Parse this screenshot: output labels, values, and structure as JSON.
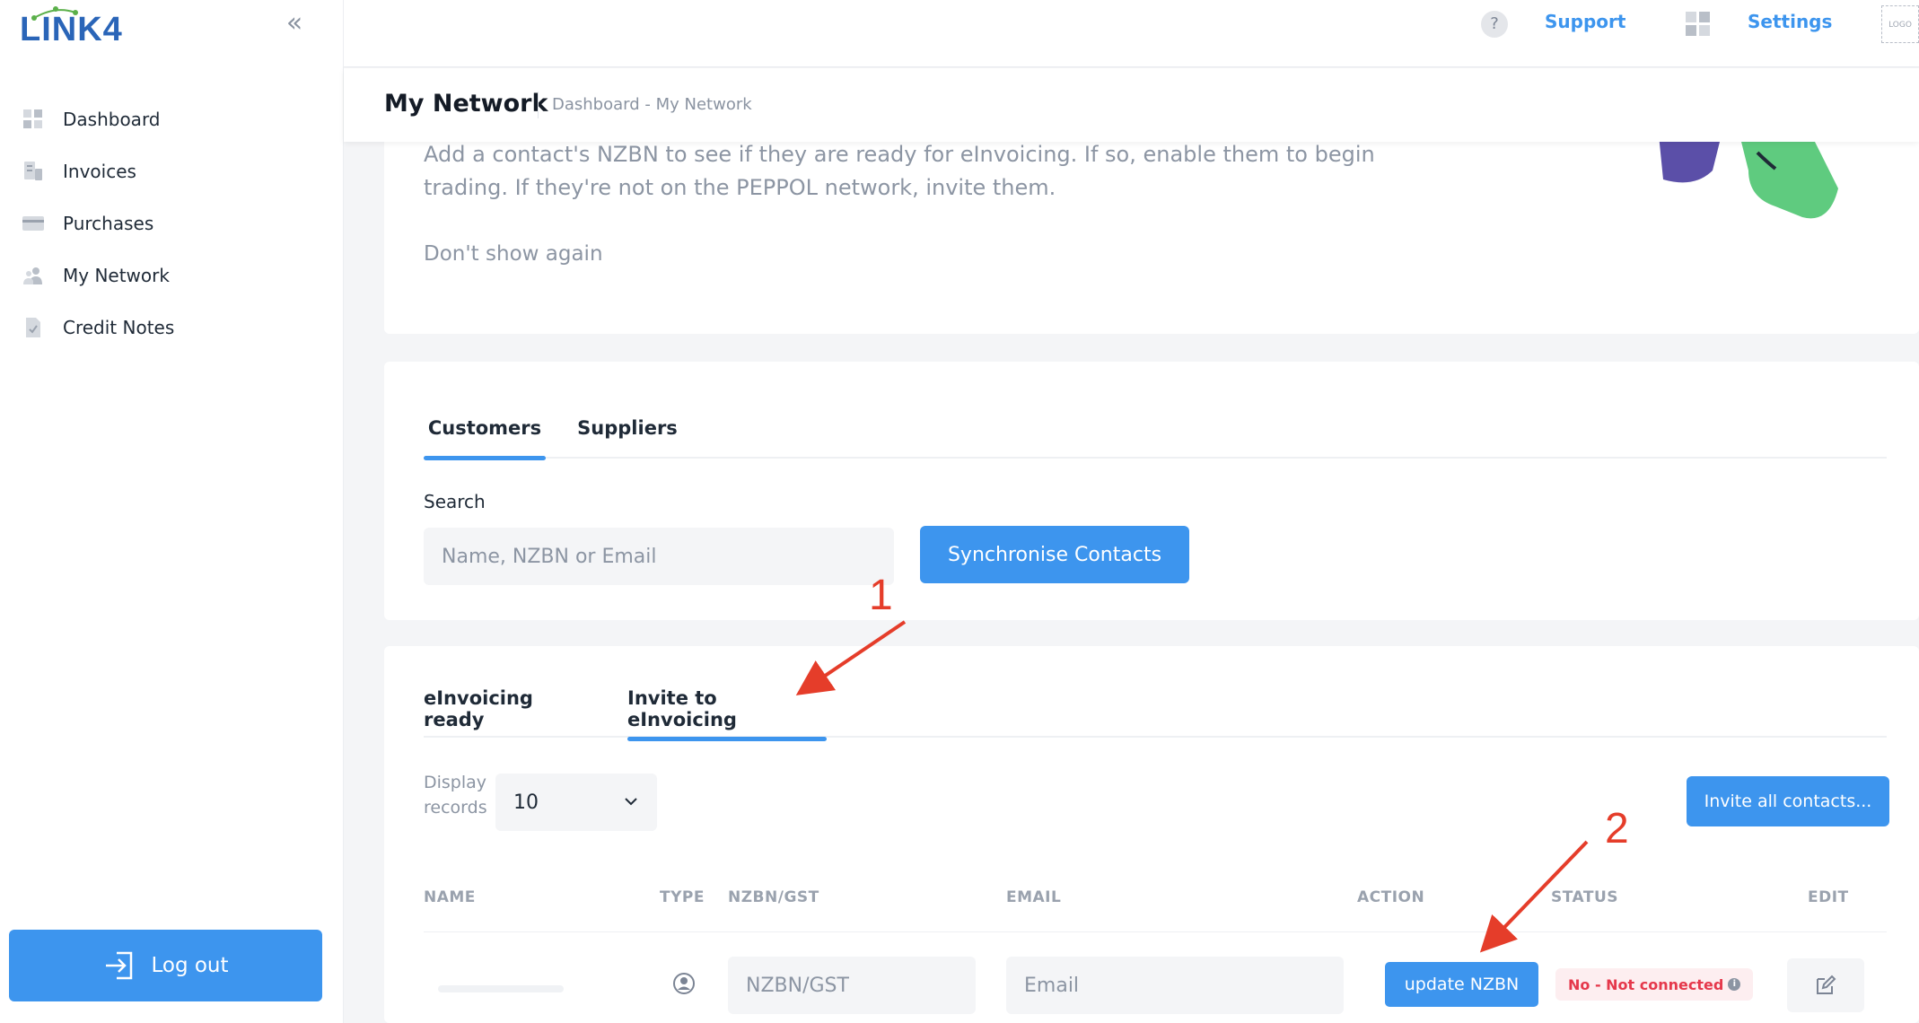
{
  "brand": {
    "name": "LINK4"
  },
  "sidebar": {
    "items": [
      {
        "label": "Dashboard",
        "icon": "dashboard-icon"
      },
      {
        "label": "Invoices",
        "icon": "invoices-icon"
      },
      {
        "label": "Purchases",
        "icon": "card-icon"
      },
      {
        "label": "My Network",
        "icon": "people-icon"
      },
      {
        "label": "Credit Notes",
        "icon": "document-check-icon"
      }
    ],
    "logout_label": "Log out"
  },
  "topbar": {
    "help_symbol": "?",
    "support_label": "Support",
    "settings_label": "Settings",
    "logo_placeholder": "LOGO"
  },
  "header": {
    "title": "My Network",
    "breadcrumb": "Dashboard - My Network"
  },
  "info": {
    "text": "Add a contact's NZBN to see if they are ready for eInvoicing. If so, enable them to begin trading. If they're not on the PEPPOL network, invite them.",
    "dont_show": "Don't show again"
  },
  "contact_tabs": [
    {
      "label": "Customers",
      "active": true
    },
    {
      "label": "Suppliers",
      "active": false
    }
  ],
  "search": {
    "label": "Search",
    "placeholder": "Name, NZBN or Email",
    "sync_label": "Synchronise Contacts"
  },
  "invite_tabs": [
    {
      "label": "eInvoicing ready",
      "active": false
    },
    {
      "label": "Invite to eInvoicing",
      "active": true
    }
  ],
  "table": {
    "display_label_line1": "Display",
    "display_label_line2": "records",
    "records_value": "10",
    "invite_all_label": "Invite all contacts...",
    "columns": [
      "NAME",
      "TYPE",
      "NZBN/GST",
      "EMAIL",
      "ACTION",
      "STATUS",
      "EDIT"
    ],
    "row": {
      "nzbn_placeholder": "NZBN/GST",
      "email_placeholder": "Email",
      "action_label": "update NZBN",
      "status": "No - Not connected",
      "info_symbol": "i"
    }
  },
  "annotations": [
    "1",
    "2"
  ],
  "colors": {
    "accent": "#3d95ee",
    "brand": "#2a65b8",
    "status_error": "#e5384b",
    "annotation": "#e53d2a"
  }
}
